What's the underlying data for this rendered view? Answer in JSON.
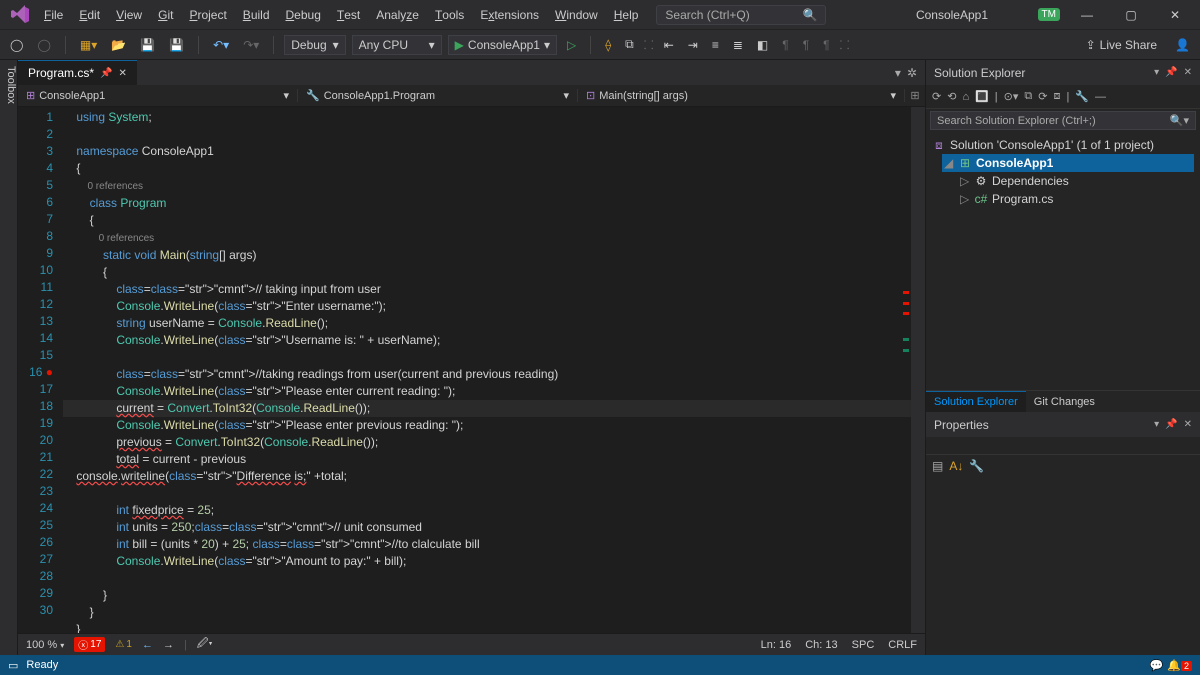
{
  "title": "ConsoleApp1",
  "menus": [
    "File",
    "Edit",
    "View",
    "Git",
    "Project",
    "Build",
    "Debug",
    "Test",
    "Analyze",
    "Tools",
    "Extensions",
    "Window",
    "Help"
  ],
  "menus_ul": [
    "F",
    "E",
    "V",
    "G",
    "P",
    "B",
    "D",
    "T",
    "z",
    "T",
    "x",
    "W",
    "H"
  ],
  "search_placeholder": "Search (Ctrl+Q)",
  "user_badge": "TM",
  "toolbar": {
    "config": "Debug",
    "platform": "Any CPU",
    "start": "ConsoleApp1",
    "liveshare": "Live Share"
  },
  "left_tool": "Toolbox",
  "doc_tab": "Program.cs*",
  "nav": {
    "proj": "ConsoleApp1",
    "ns": "ConsoleApp1.Program",
    "member": "Main(string[] args)"
  },
  "code_lines": [
    "using System;",
    "",
    "namespace ConsoleApp1",
    "{",
    "    0 references",
    "    class Program",
    "    {",
    "        0 references",
    "        static void Main(string[] args)",
    "        {",
    "            // taking input from user",
    "            Console.WriteLine(\"Enter username:\");",
    "            string userName = Console.ReadLine();",
    "            Console.WriteLine(\"Username is: \" + userName);",
    "",
    "            //taking readings from user(current and previous reading)",
    "            Console.WriteLine(\"Please enter current reading: \");",
    "            current = Convert.ToInt32(Console.ReadLine());",
    "            Console.WriteLine(\"Please enter previous reading: \");",
    "            previous = Convert.ToInt32(Console.ReadLine());",
    "            total = current - previous",
    "console.writeline(\"Difference is;\" +total;",
    "",
    "            int fixedprice = 25;",
    "            int units = 250;// unit consumed",
    "            int bill = (units * 20) + 25; //to clalculate bill",
    "            Console.WriteLine(\"Amount to pay:\" + bill);",
    "",
    "        }",
    "    }",
    "}",
    ""
  ],
  "line_numbers": [
    1,
    2,
    3,
    4,
    null,
    5,
    6,
    null,
    7,
    8,
    9,
    10,
    11,
    12,
    13,
    14,
    15,
    16,
    17,
    18,
    19,
    20,
    21,
    22,
    23,
    24,
    25,
    26,
    27,
    28,
    29,
    30
  ],
  "current_line_marker": 16,
  "editor_bottom": {
    "zoom": "100 %",
    "errors": "17",
    "warnings": "1",
    "ln": "Ln: 16",
    "ch": "Ch: 13",
    "spc": "SPC",
    "crlf": "CRLF"
  },
  "solution_explorer": {
    "title": "Solution Explorer",
    "search_placeholder": "Search Solution Explorer (Ctrl+;)",
    "root": "Solution 'ConsoleApp1' (1 of 1 project)",
    "project": "ConsoleApp1",
    "deps": "Dependencies",
    "file": "Program.cs",
    "tabs": [
      "Solution Explorer",
      "Git Changes"
    ]
  },
  "properties": {
    "title": "Properties"
  },
  "statusbar": {
    "ready": "Ready",
    "notif_count": "2"
  }
}
